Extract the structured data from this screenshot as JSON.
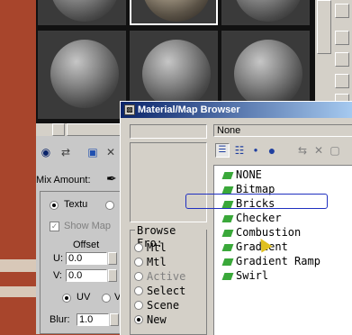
{
  "browser": {
    "title": "Material/Map Browser",
    "none_label": "None",
    "browse_from": {
      "legend": "Browse Fro:",
      "options": [
        {
          "label": "Mtl",
          "selected": false,
          "enabled": true
        },
        {
          "label": "Mtl",
          "selected": false,
          "enabled": true
        },
        {
          "label": "Active",
          "selected": false,
          "enabled": false
        },
        {
          "label": "Select",
          "selected": false,
          "enabled": true
        },
        {
          "label": "Scene",
          "selected": false,
          "enabled": true
        },
        {
          "label": "New",
          "selected": true,
          "enabled": true
        }
      ]
    },
    "maps": [
      "NONE",
      "Bitmap",
      "Bricks",
      "Checker",
      "Combustion",
      "Gradient",
      "Gradient Ramp",
      "Swirl"
    ],
    "hovered_map": "Bricks"
  },
  "material_editor": {
    "mix_amount_label": "Mix Amount:",
    "texture_label": "Textu",
    "show_map_label": "Show Map",
    "offset_label": "Offset",
    "u_label": "U:",
    "v_label": "V:",
    "u_value": "0.0",
    "v_value": "0.0",
    "uv_label": "UV",
    "vw_label": "V",
    "blur_label": "Blur:",
    "blur_value": "1.0"
  },
  "colors": {
    "titlebar_start": "#0a246a",
    "titlebar_end": "#a6caf0",
    "map_icon": "#3aa83a",
    "selection_border": "#2030c0",
    "background_brick": "#a8452c"
  }
}
